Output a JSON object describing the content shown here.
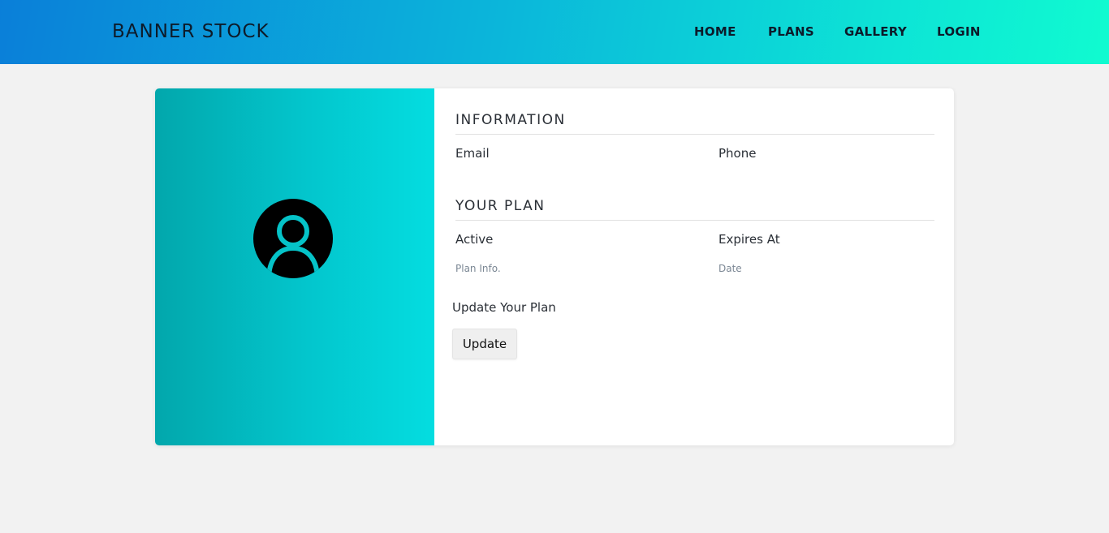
{
  "header": {
    "brand": "BANNER STOCK",
    "nav": [
      "HOME",
      "PLANS",
      "GALLERY",
      "LOGIN"
    ]
  },
  "information": {
    "title": "INFORMATION",
    "email_label": "Email",
    "phone_label": "Phone"
  },
  "plan": {
    "title": "YOUR PLAN",
    "active_label": "Active",
    "active_value": "Plan Info.",
    "expires_label": "Expires At",
    "expires_value": "Date",
    "update_prompt": "Update Your Plan",
    "update_button": "Update"
  },
  "colors": {
    "header_gradient_start": "#0a7fd9",
    "header_gradient_end": "#10fbd0",
    "panel_gradient_start": "#02a7ac",
    "panel_gradient_end": "#04dde0",
    "avatar_bg": "#000000",
    "avatar_fg": "#05c3c8"
  },
  "icons": {
    "avatar": "user-circle-icon"
  }
}
